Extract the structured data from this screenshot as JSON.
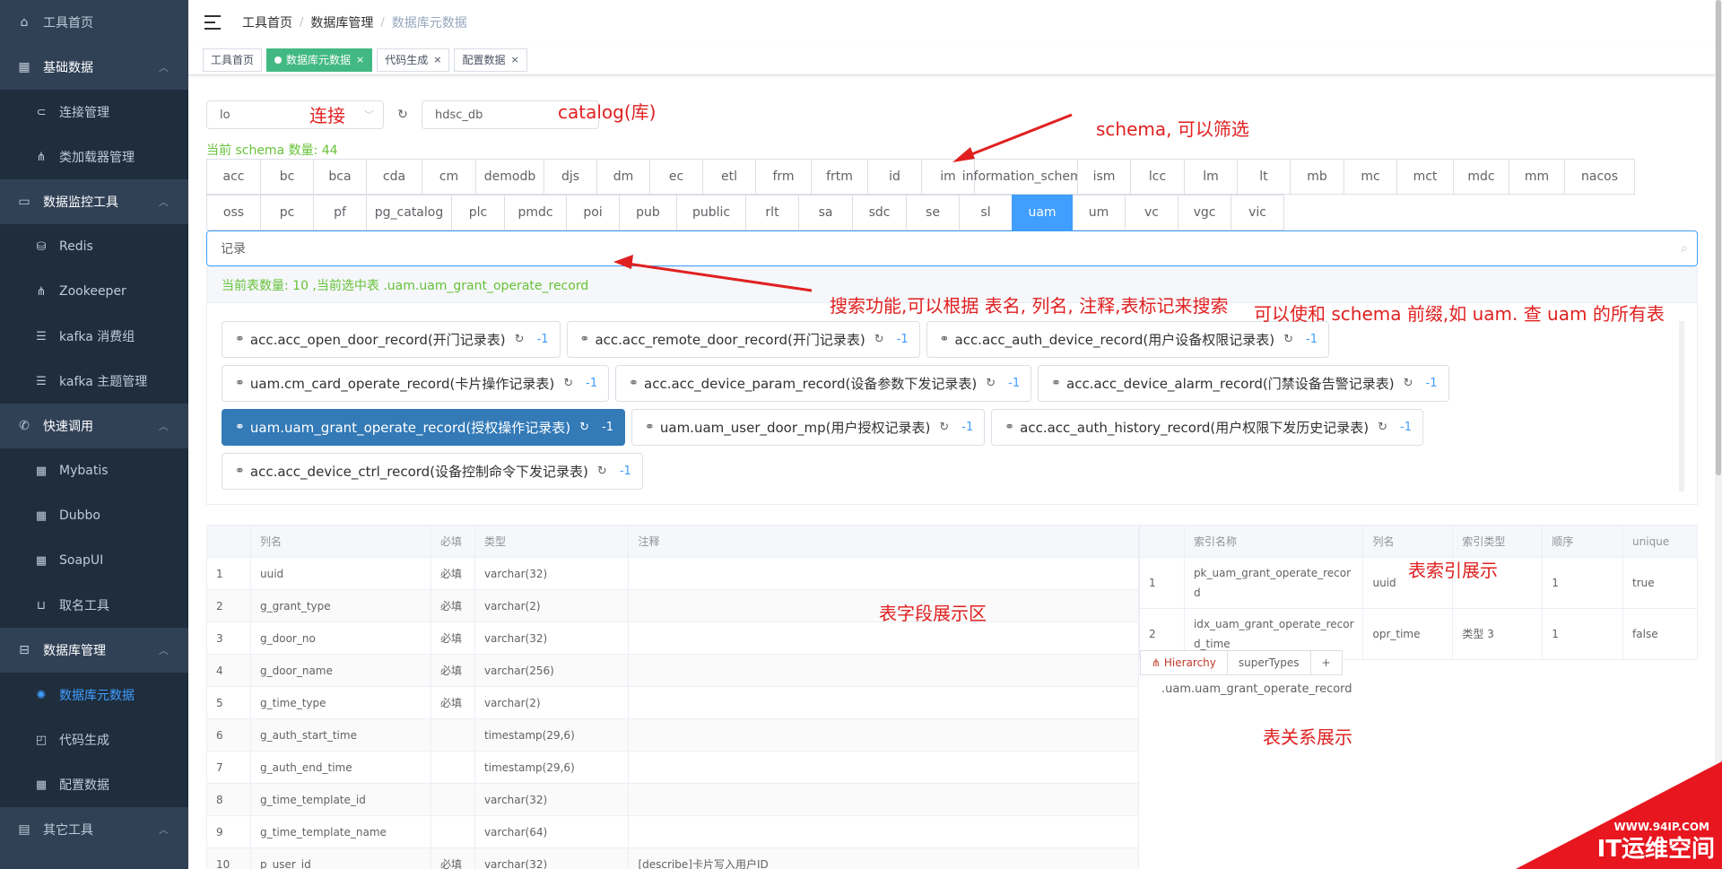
{
  "sidebar": {
    "items": [
      {
        "label": "工具首页",
        "icon": "home-icon"
      },
      {
        "label": "基础数据",
        "icon": "building-icon",
        "children": [
          {
            "label": "连接管理",
            "icon": "link-icon"
          },
          {
            "label": "类加载器管理",
            "icon": "tree-icon"
          }
        ]
      },
      {
        "label": "数据监控工具",
        "icon": "monitor-icon",
        "children": [
          {
            "label": "Redis",
            "icon": "database-icon"
          },
          {
            "label": "Zookeeper",
            "icon": "tree-icon"
          },
          {
            "label": "kafka 消费组",
            "icon": "list-icon"
          },
          {
            "label": "kafka 主题管理",
            "icon": "list-icon"
          }
        ]
      },
      {
        "label": "快速调用",
        "icon": "phone-icon",
        "children": [
          {
            "label": "Mybatis",
            "icon": "grid-icon"
          },
          {
            "label": "Dubbo",
            "icon": "grid-icon"
          },
          {
            "label": "SoapUI",
            "icon": "grid-icon"
          },
          {
            "label": "取名工具",
            "icon": "cart-icon"
          }
        ]
      },
      {
        "label": "数据库管理",
        "icon": "database-manage-icon",
        "children": [
          {
            "label": "数据库元数据",
            "icon": "spinner-icon",
            "active": true
          },
          {
            "label": "代码生成",
            "icon": "code-icon"
          },
          {
            "label": "配置数据",
            "icon": "grid-icon"
          }
        ]
      },
      {
        "label": "其它工具",
        "icon": "box-icon"
      }
    ]
  },
  "breadcrumb": [
    "工具首页",
    "数据库管理",
    "数据库元数据"
  ],
  "tags": [
    {
      "label": "工具首页",
      "active": false,
      "closable": false
    },
    {
      "label": "数据库元数据",
      "active": true,
      "closable": true
    },
    {
      "label": "代码生成",
      "active": false,
      "closable": true
    },
    {
      "label": "配置数据",
      "active": false,
      "closable": true
    }
  ],
  "connection": {
    "value": "lo",
    "catalog": "hdsc_db"
  },
  "schema_count": "当前 schema 数量: 44",
  "schemas_row1": [
    "acc",
    "bc",
    "bca",
    "cda",
    "cm",
    "demodb",
    "djs",
    "dm",
    "ec",
    "etl",
    "frm",
    "frtm",
    "id",
    "im",
    "information_schema",
    "ism",
    "lcc",
    "lm",
    "lt",
    "mb",
    "mc",
    "mct",
    "mdc",
    "mm",
    "nacos"
  ],
  "schemas_row2": [
    "oss",
    "pc",
    "pf",
    "pg_catalog",
    "plc",
    "pmdc",
    "poi",
    "pub",
    "public",
    "rlt",
    "sa",
    "sdc",
    "se",
    "sl",
    "uam",
    "um",
    "vc",
    "vgc",
    "vic"
  ],
  "active_schema": "uam",
  "search": {
    "value": "记录"
  },
  "table_summary": "当前表数量: 10 ,当前选中表 .uam.uam_grant_operate_record",
  "tables": [
    [
      {
        "label": "acc.acc_open_door_record(开门记录表)",
        "count": "-1"
      },
      {
        "label": "acc.acc_remote_door_record(开门记录表)",
        "count": "-1"
      },
      {
        "label": "acc.acc_auth_device_record(用户设备权限记录表)",
        "count": "-1"
      }
    ],
    [
      {
        "label": "uam.cm_card_operate_record(卡片操作记录表)",
        "count": "-1"
      },
      {
        "label": "acc.acc_device_param_record(设备参数下发记录表)",
        "count": "-1"
      },
      {
        "label": "acc.acc_device_alarm_record(门禁设备告警记录表)",
        "count": "-1"
      }
    ],
    [
      {
        "label": "uam.uam_grant_operate_record(授权操作记录表)",
        "count": "-1",
        "active": true
      },
      {
        "label": "uam.uam_user_door_mp(用户授权记录表)",
        "count": "-1"
      },
      {
        "label": "acc.acc_auth_history_record(用户权限下发历史记录表)",
        "count": "-1"
      }
    ],
    [
      {
        "label": "acc.acc_device_ctrl_record(设备控制命令下发记录表)",
        "count": "-1"
      }
    ]
  ],
  "columns_table": {
    "headers": [
      "",
      "列名",
      "必填",
      "类型",
      "注释"
    ],
    "rows": [
      [
        "1",
        "uuid",
        "必填",
        "varchar(32)",
        ""
      ],
      [
        "2",
        "g_grant_type",
        "必填",
        "varchar(2)",
        ""
      ],
      [
        "3",
        "g_door_no",
        "必填",
        "varchar(32)",
        ""
      ],
      [
        "4",
        "g_door_name",
        "必填",
        "varchar(256)",
        ""
      ],
      [
        "5",
        "g_time_type",
        "必填",
        "varchar(2)",
        ""
      ],
      [
        "6",
        "g_auth_start_time",
        "",
        "timestamp(29,6)",
        ""
      ],
      [
        "7",
        "g_auth_end_time",
        "",
        "timestamp(29,6)",
        ""
      ],
      [
        "8",
        "g_time_template_id",
        "",
        "varchar(32)",
        ""
      ],
      [
        "9",
        "g_time_template_name",
        "",
        "varchar(64)",
        ""
      ],
      [
        "10",
        "p_user_id",
        "必填",
        "varchar(32)",
        "[describe]卡片写入用户ID"
      ]
    ]
  },
  "index_table": {
    "headers": [
      "",
      "索引名称",
      "列名",
      "索引类型",
      "顺序",
      "unique"
    ],
    "rows": [
      [
        "1",
        "pk_uam_grant_operate_record",
        "uuid",
        "",
        "1",
        "true"
      ],
      [
        "2",
        "idx_uam_grant_operate_record_time",
        "opr_time",
        "类型 3",
        "1",
        "false"
      ]
    ]
  },
  "relation_tabs": [
    "Hierarchy",
    "superTypes",
    "+"
  ],
  "relation_text": ".uam.uam_grant_operate_record",
  "annotations": {
    "conn": "连接",
    "catalog": "catalog(库)",
    "schema": "schema, 可以筛选",
    "search": "搜索功能,可以根据 表名, 列名, 注释,表标记来搜索",
    "prefix": "可以使和 schema 前缀,如 uam. 查 uam 的所有表",
    "fields": "表字段展示区",
    "index": "表索引展示",
    "relation": "表关系展示"
  },
  "watermark": {
    "url": "WWW.94IP.COM",
    "brand": "IT运维空间"
  },
  "colors": {
    "sidebar_bg": "#304156",
    "active_blue": "#409eff",
    "tag_green": "#42b983",
    "annotation_red": "#e02020"
  }
}
